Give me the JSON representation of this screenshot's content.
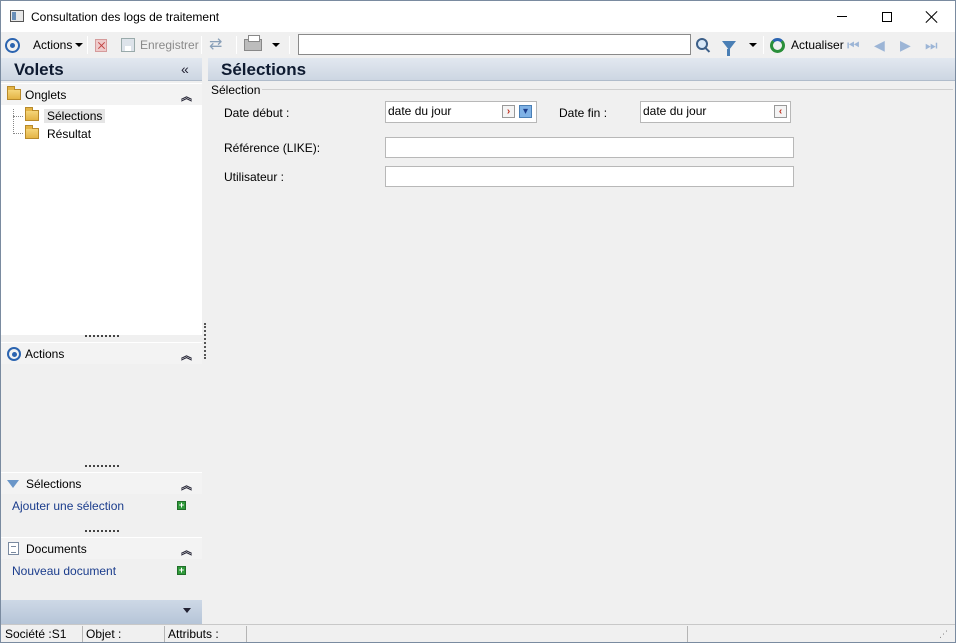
{
  "window": {
    "title": "Consultation des logs de traitement"
  },
  "toolbar": {
    "actions_label": "Actions",
    "save_label": "Enregistrer",
    "search_value": "",
    "refresh_label": "Actualiser"
  },
  "left_panel": {
    "title": "Volets",
    "onglets": {
      "label": "Onglets",
      "items": [
        {
          "label": "Sélections",
          "selected": true
        },
        {
          "label": "Résultat",
          "selected": false
        }
      ]
    },
    "actions": {
      "label": "Actions"
    },
    "selections": {
      "label": "Sélections",
      "link": "Ajouter une sélection"
    },
    "documents": {
      "label": "Documents",
      "link": "Nouveau document"
    }
  },
  "main": {
    "title": "Sélections",
    "group_label": "Sélection",
    "date_debut": {
      "label": "Date début :",
      "value": "date du jour"
    },
    "date_fin": {
      "label": "Date fin :",
      "value": "date du jour"
    },
    "reference": {
      "label": "Référence (LIKE):",
      "value": ""
    },
    "utilisateur": {
      "label": "Utilisateur :",
      "value": ""
    }
  },
  "status_bar": {
    "societe": "Société :S1",
    "objet": "Objet :",
    "attributs": "Attributs :"
  },
  "colors": {
    "accent": "#2b64b0",
    "header_gradient_top": "#e2e8f0",
    "header_gradient_bottom": "#cdd6e2",
    "link": "#1a3c8c",
    "add_green": "#2f9a3a"
  }
}
